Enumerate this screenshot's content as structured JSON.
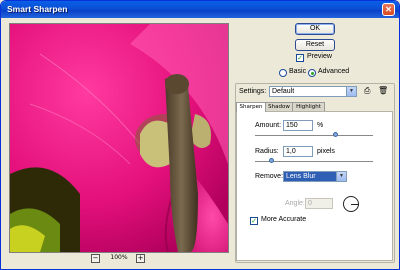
{
  "window": {
    "title": "Smart Sharpen",
    "close_glyph": "✕"
  },
  "preview": {
    "zoom_label": "100%",
    "zoom_out": "−",
    "zoom_in": "+"
  },
  "actions": {
    "ok": "OK",
    "reset": "Reset"
  },
  "preview_toggle": {
    "label": "Preview",
    "checked": true
  },
  "mode": {
    "basic": "Basic",
    "advanced": "Advanced",
    "selected": "Advanced"
  },
  "settings": {
    "label": "Settings:",
    "value": "Default"
  },
  "tabs": [
    {
      "label": "Sharpen",
      "active": true
    },
    {
      "label": "Shadow",
      "active": false
    },
    {
      "label": "Highlight",
      "active": false
    }
  ],
  "sharpen": {
    "amount": {
      "label": "Amount:",
      "value": "150",
      "unit": "%",
      "slider_fraction": 0.75
    },
    "radius": {
      "label": "Radius:",
      "value": "1,0",
      "unit": "pixels",
      "slider_fraction": 0.06
    },
    "remove": {
      "label": "Remove:",
      "value": "Lens Blur"
    },
    "angle": {
      "label": "Angle:",
      "value": "0"
    },
    "more_accurate": {
      "label": "More Accurate",
      "checked": true
    }
  },
  "colors": {
    "titlebar": "#0a4fd6",
    "selection": "#2f5fb5",
    "dialog_bg": "#ece9d8"
  }
}
